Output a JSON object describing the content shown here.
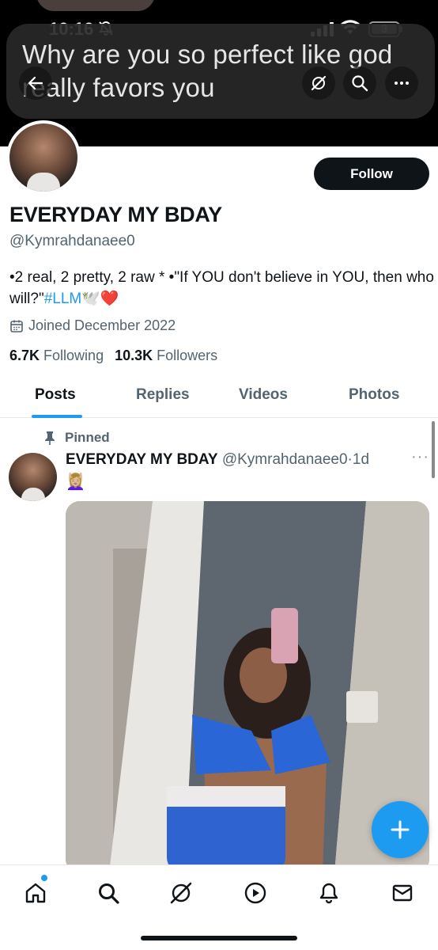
{
  "status_bar": {
    "time": "10:16",
    "battery": "3"
  },
  "caption": {
    "text": "Why are you so perfect like god really favors you"
  },
  "profile": {
    "follow_label": "Follow",
    "display_name": "EVERYDAY MY BDAY",
    "handle": "@Kymrahdanaee0",
    "bio_text": "•2 real, 2 pretty, 2 raw * •\"If YOU don't believe in YOU, then who will?\"",
    "bio_hashtag": "#LLM",
    "bio_emojis": "🕊️❤️",
    "joined": "Joined December 2022",
    "following_count": "6.7K",
    "following_label": "Following",
    "followers_count": "10.3K",
    "followers_label": "Followers"
  },
  "tabs": [
    {
      "label": "Posts",
      "active": true
    },
    {
      "label": "Replies",
      "active": false
    },
    {
      "label": "Videos",
      "active": false
    },
    {
      "label": "Photos",
      "active": false
    }
  ],
  "post": {
    "pinned_label": "Pinned",
    "author_name": "EVERYDAY MY BDAY",
    "author_handle": "@Kymrahdanaee0",
    "separator": "·",
    "time_ago": "1d",
    "more": "···",
    "text": "💆🏼‍♀️"
  },
  "colors": {
    "accent": "#1d9bf0",
    "text_primary": "#0f1419",
    "text_secondary": "#536471"
  },
  "bottom_nav": {
    "items": [
      "home-icon",
      "search-icon",
      "grok-icon",
      "video-icon",
      "notifications-icon",
      "messages-icon"
    ]
  }
}
